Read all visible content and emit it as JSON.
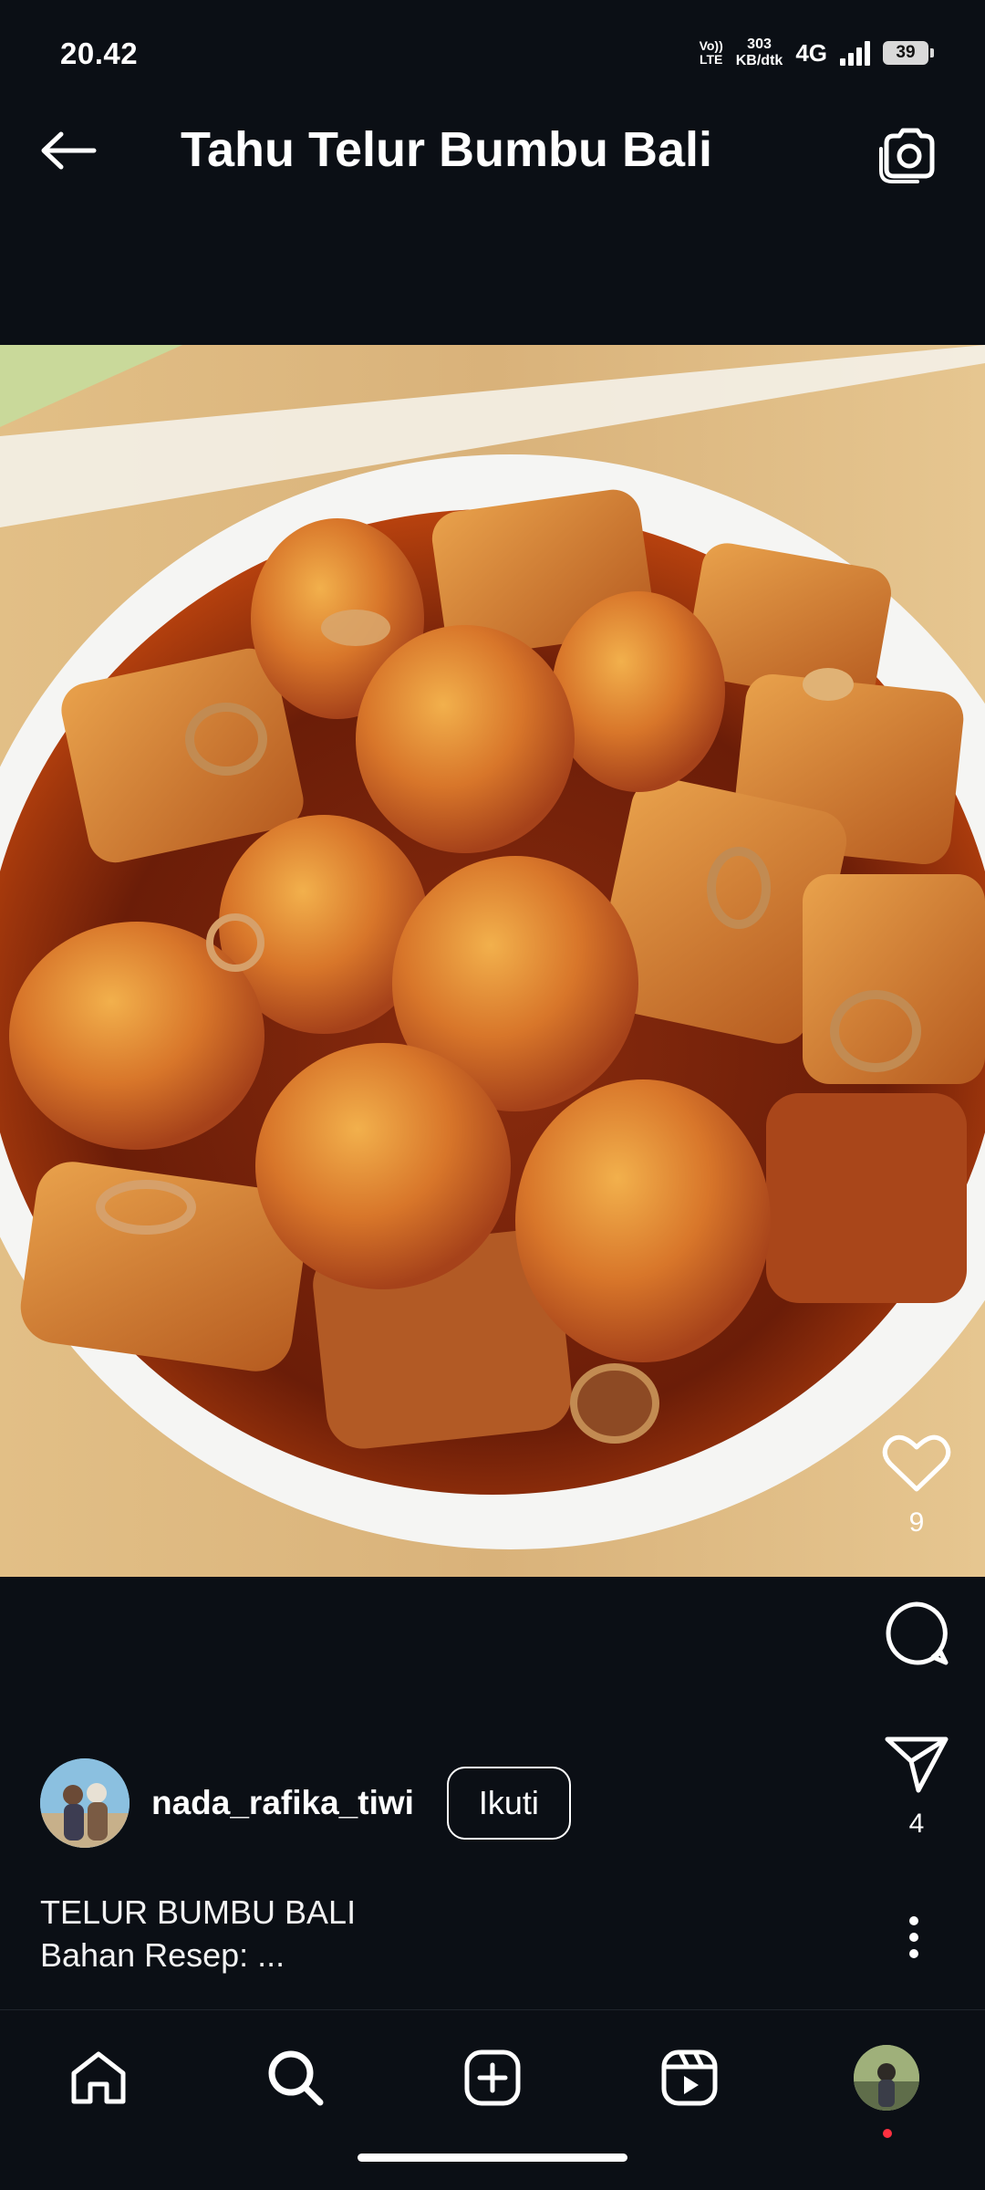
{
  "status_bar": {
    "time": "20.42",
    "volte_top": "Vo))",
    "volte_bottom": "LTE",
    "speed_value": "303",
    "speed_unit": "KB/dtk",
    "network": "4G",
    "battery": "39"
  },
  "app_bar": {
    "title": "Tahu Telur Bumbu Bali"
  },
  "post": {
    "likes_count": "9",
    "shares_count": "4",
    "author": {
      "username": "nada_rafika_tiwi",
      "follow_label": "Ikuti"
    },
    "caption_line1": "TELUR BUMBU BALI",
    "caption_line2": "Bahan Resep: ..."
  },
  "icons": {
    "back": "arrow-left-icon",
    "camera": "camera-icon",
    "like": "heart-icon",
    "comment": "comment-icon",
    "share": "send-icon",
    "more": "more-vertical-icon",
    "home": "home-icon",
    "search": "search-icon",
    "create": "plus-square-icon",
    "reels": "reels-icon"
  }
}
